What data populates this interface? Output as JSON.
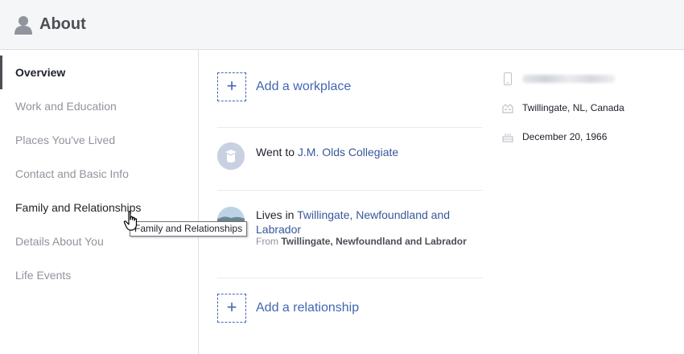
{
  "header": {
    "title": "About",
    "icon": "person-icon"
  },
  "sidebar": {
    "items": [
      {
        "label": "Overview",
        "state": "active"
      },
      {
        "label": "Work and Education",
        "state": "normal"
      },
      {
        "label": "Places You've Lived",
        "state": "normal"
      },
      {
        "label": "Contact and Basic Info",
        "state": "normal"
      },
      {
        "label": "Family and Relationships",
        "state": "hover"
      },
      {
        "label": "Details About You",
        "state": "normal"
      },
      {
        "label": "Life Events",
        "state": "normal"
      }
    ]
  },
  "tooltip": {
    "text": "Family and Relationships"
  },
  "main": {
    "add_workplace": {
      "plus": "+",
      "label": "Add a workplace"
    },
    "education": {
      "prefix": "Went to ",
      "school": "J.M. Olds Collegiate"
    },
    "lives": {
      "prefix": "Lives in ",
      "place_line1": "Twillingate, Newfoundland and",
      "place_line2": "Labrador",
      "from_prefix": "From ",
      "from_place": "Twillingate, Newfoundland and Labrador"
    },
    "add_relationship": {
      "plus": "+",
      "label": "Add a relationship"
    }
  },
  "right": {
    "phone_icon": "phone-icon",
    "hometown_icon": "buildings-icon",
    "hometown": "Twillingate, NL, Canada",
    "birthday_icon": "cake-icon",
    "birthday": "December 20, 1966"
  },
  "colors": {
    "link": "#4267b2",
    "muted": "#90949c",
    "header_bg": "#f5f6f7"
  }
}
